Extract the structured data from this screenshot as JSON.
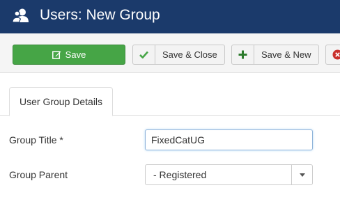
{
  "header": {
    "title": "Users: New Group",
    "icon": "users-icon"
  },
  "toolbar": {
    "save_label": "Save",
    "save_close_label": "Save & Close",
    "save_new_label": "Save & New",
    "colors": {
      "save_bg": "#46a546",
      "check": "#46a546",
      "plus": "#2b7a2b",
      "cancel": "#c9302c"
    }
  },
  "tabs": [
    {
      "label": "User Group Details"
    }
  ],
  "form": {
    "group_title_label": "Group Title *",
    "group_title_value": "FixedCatUG",
    "group_parent_label": "Group Parent",
    "group_parent_value": "- Registered"
  },
  "colors": {
    "header_bg": "#1b3a6b"
  }
}
